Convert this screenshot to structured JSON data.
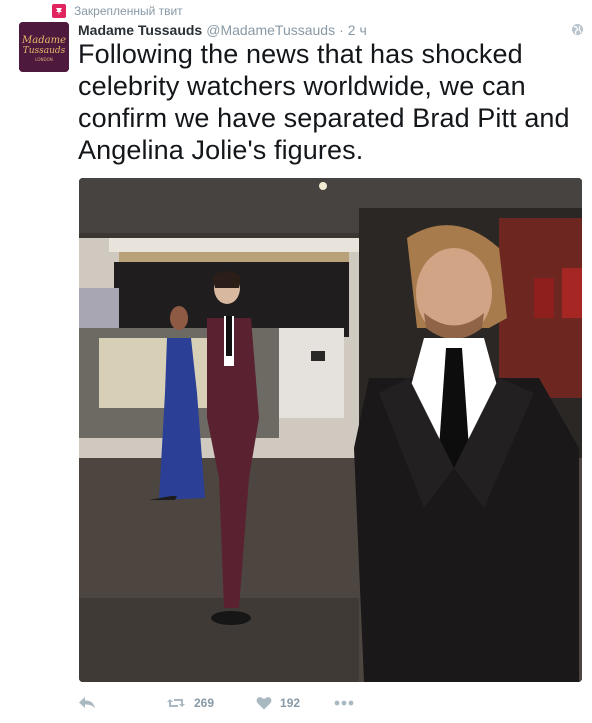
{
  "pinned": {
    "label": "Закрепленный твит",
    "icon": "pin-icon"
  },
  "author": {
    "display_name": "Madame Tussauds",
    "screen_name": "@MadameTussauds",
    "timestamp": "2 ч",
    "avatar_text_1": "Madame",
    "avatar_text_2": "Tussauds",
    "avatar_text_3": "LONDON"
  },
  "tweet": {
    "text": "Following the news that has shocked celebrity watchers worldwide, we can confirm we have separated Brad Pitt and Angelina Jolie's figures."
  },
  "actions": {
    "reply_icon": "reply-icon",
    "retweet_icon": "retweet-icon",
    "retweet_count": "269",
    "like_icon": "heart-icon",
    "like_count": "192",
    "more_icon": "more-icon"
  },
  "colors": {
    "muted": "#8899a6",
    "text": "#14171a",
    "pin_red": "#e0245e"
  }
}
